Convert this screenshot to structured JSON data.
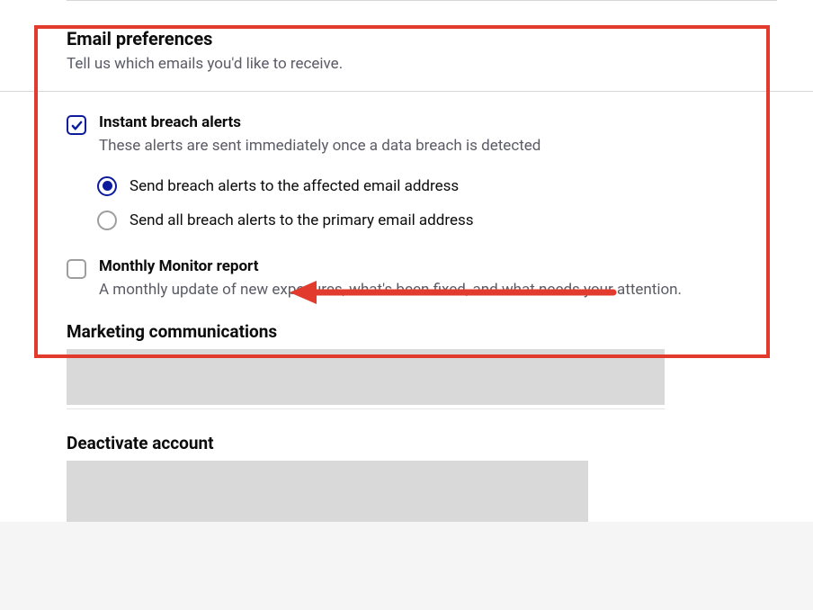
{
  "emailPrefs": {
    "title": "Email preferences",
    "subtitle": "Tell us which emails you'd like to receive.",
    "instantAlerts": {
      "title": "Instant breach alerts",
      "desc": "These alerts are sent immediately once a data breach is detected",
      "radioAffected": "Send breach alerts to the affected email address",
      "radioPrimary": "Send all breach alerts to the primary email address"
    },
    "monthlyReport": {
      "title": "Monthly Monitor report",
      "desc": "A monthly update of new exposures, what's been fixed, and what needs your attention."
    }
  },
  "marketing": {
    "title": "Marketing communications"
  },
  "deactivate": {
    "title": "Deactivate account"
  },
  "annotationColor": "#e23b2e"
}
